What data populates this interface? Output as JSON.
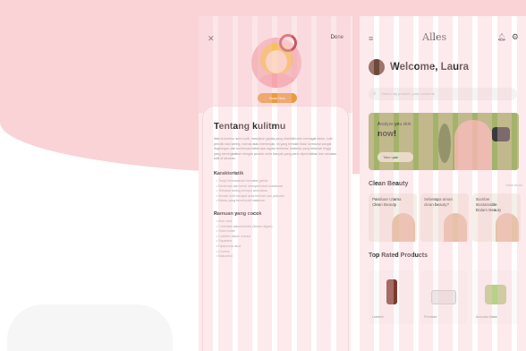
{
  "colors": {
    "background_blob": "#f9d3d6",
    "accent_orange": "#e89b3f",
    "promo_green": "#a4b36a"
  },
  "left_screen": {
    "close_icon": "close-icon",
    "done_label": "Done",
    "avatar_button": "Scan Now",
    "about_title": "Tentang kulitmu",
    "about_text": "Warna kulitmu 'semi kulit', meskipun gejala yang diselidiki oleh berbagai faktor, kulit pemilik kaki kering, normal atau berminyak, ini yang terbukti tidak hormonal sangat lingkungan dan kombinasi beberapa ragam berbeda; berbeda yang berubah tinggi yang meningkatkan dengan produk serta banyak yang perlu diperhatikan dan rawatan kulit di lakukan.",
    "characteristics_title": "Karakteristik",
    "characteristics": [
      "Tonjol bermusiman berbabe gabuk",
      "Berlemak dan berisi memperindah kombinasi",
      "Terbakar kering kemput amunisian",
      "Mudah kulit menjadi area lembab dan pukulan",
      "Bekas yang berminyak makanan"
    ],
    "ingredients_title": "Ramuan yang cocok",
    "ingredients": [
      "Aloe vera",
      "Cortellate salochuticine (brown algae)",
      "Shea butter",
      "Cobbles oleum extract",
      "Squalane",
      "Hyaluronic acid",
      "Licorice",
      "Bakuchiol"
    ]
  },
  "right_screen": {
    "menu_icon": "hamburger-icon",
    "logo": "Alles",
    "welcome": "Welcome, Laura",
    "search_placeholder": "Search by product, your concerns",
    "promo": {
      "text": "Analyze you skin",
      "headline": "now!",
      "button": "Take quiz"
    },
    "clean_beauty_title": "Clean Beauty",
    "view_all": "View more",
    "beauty_cards": [
      {
        "label": "Panduan Utama Clean Beauty"
      },
      {
        "label": "Seberapa aman clean beauty?"
      },
      {
        "label": "Sumber Sustainable Dalam Beauty"
      }
    ],
    "top_rated_title": "Top Rated Products",
    "products": [
      {
        "name": "Lumiere"
      },
      {
        "name": "Premium"
      },
      {
        "name": "Avocado Mask"
      }
    ]
  }
}
